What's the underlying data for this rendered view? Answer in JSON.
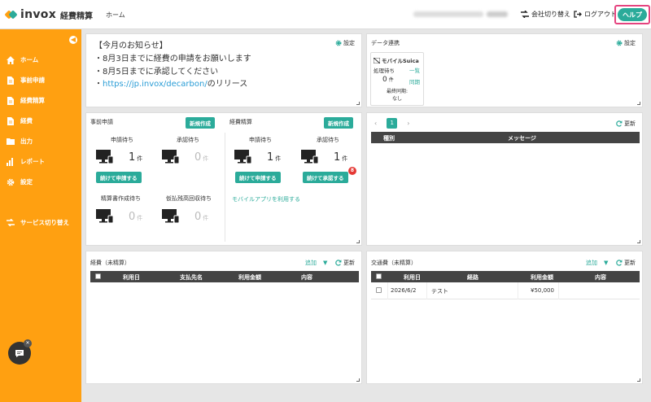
{
  "header": {
    "logo_text": "invox",
    "logo_sub": "経費精算",
    "home": "ホーム",
    "company_switch": "会社切り替え",
    "logout": "ログアウト",
    "help": "ヘルプ"
  },
  "sidebar": {
    "items": [
      {
        "label": "ホーム",
        "icon": "home-icon"
      },
      {
        "label": "事前申請",
        "icon": "document-icon"
      },
      {
        "label": "経費精算",
        "icon": "document-icon"
      },
      {
        "label": "経費",
        "icon": "document-icon"
      },
      {
        "label": "出力",
        "icon": "folder-icon"
      },
      {
        "label": "レポート",
        "icon": "bar-chart-icon"
      },
      {
        "label": "設定",
        "icon": "gear-icon"
      },
      {
        "label": "サービス切り替え",
        "icon": "switch-icon"
      }
    ]
  },
  "notice": {
    "title": "【今月のお知らせ】",
    "settings": "設定",
    "lines": [
      "・8月3日までに経費の申請をお願いします",
      "・8月5日までに承認してください"
    ],
    "link_prefix": "・",
    "link": "https://jp.invox/decarbon/",
    "link_suffix": "のリリース"
  },
  "data_link": {
    "title": "データ連携",
    "settings": "設定",
    "card": {
      "name": "モバイルSuica",
      "pending_label": "処理待ち",
      "list_link": "一覧",
      "count": "0",
      "unit": "件",
      "sync_link": "同期",
      "last_sync_label": "最終同期:",
      "last_sync_value": "なし"
    }
  },
  "pre_application": {
    "title": "事前申請",
    "new_button": "新規作成",
    "apply_wait_label": "申請待ち",
    "apply_wait_count": "1",
    "approve_wait_label": "承認待ち",
    "approve_wait_count": "0",
    "unit": "件",
    "continue_apply": "続けて申請する",
    "report_wait_label": "精算書作成待ち",
    "report_wait_count": "0",
    "advance_wait_label": "仮払残高回収待ち",
    "advance_wait_count": "0"
  },
  "expense_settlement": {
    "title": "経費精算",
    "new_button": "新規作成",
    "apply_wait_label": "申請待ち",
    "apply_wait_count": "1",
    "approve_wait_label": "承認待ち",
    "approve_wait_count": "1",
    "unit": "件",
    "continue_apply": "続けて申請する",
    "continue_approve": "続けて承認する",
    "badge": "8",
    "mobile_app_link": "モバイルアプリを利用する"
  },
  "messages": {
    "page": "1",
    "refresh": "更新",
    "columns": [
      "種別",
      "メッセージ"
    ]
  },
  "expenses": {
    "title": "経費（未精算）",
    "add": "追加",
    "refresh": "更新",
    "columns": [
      "利用日",
      "支払先名",
      "利用金額",
      "内容"
    ]
  },
  "transport": {
    "title": "交通費（未精算）",
    "add": "追加",
    "refresh": "更新",
    "columns": [
      "利用日",
      "経路",
      "利用金額",
      "内容"
    ],
    "rows": [
      {
        "date": "2026/6/2",
        "route": "テスト",
        "amount": "¥50,000",
        "content": ""
      }
    ]
  },
  "colors": {
    "accent": "#ffa011",
    "teal": "#2bab9a",
    "help_border": "#e5437f"
  }
}
